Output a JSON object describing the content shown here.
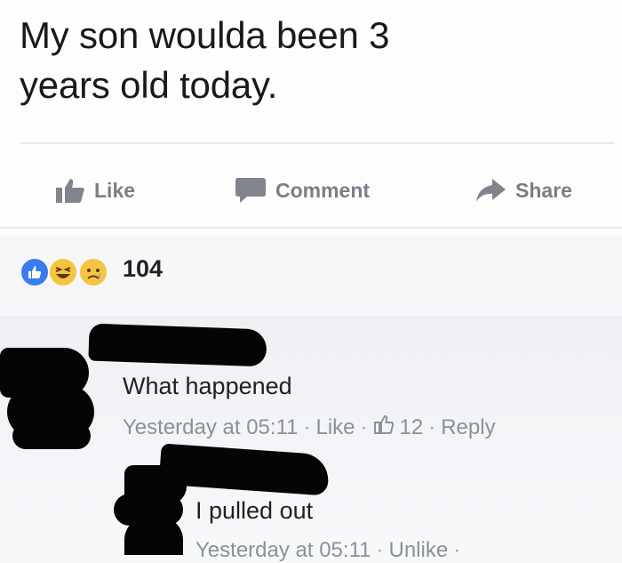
{
  "post": {
    "text_line1": "My son woulda been 3",
    "text_line2": "years old today."
  },
  "actions": {
    "like": "Like",
    "comment": "Comment",
    "share": "Share"
  },
  "reactions": {
    "count": "104",
    "types": [
      "like-icon",
      "haha-icon",
      "sad-icon"
    ],
    "colors": {
      "like": "#3b7bf0",
      "emoji": "#f5c542"
    }
  },
  "comments": [
    {
      "text": "What happened",
      "time": "Yesterday at 05:11",
      "like_label": "Like",
      "like_count": "12",
      "reply_label": "Reply"
    },
    {
      "text": "I pulled out",
      "time": "Yesterday at 05:11",
      "unlike_label": "Unlike"
    }
  ]
}
